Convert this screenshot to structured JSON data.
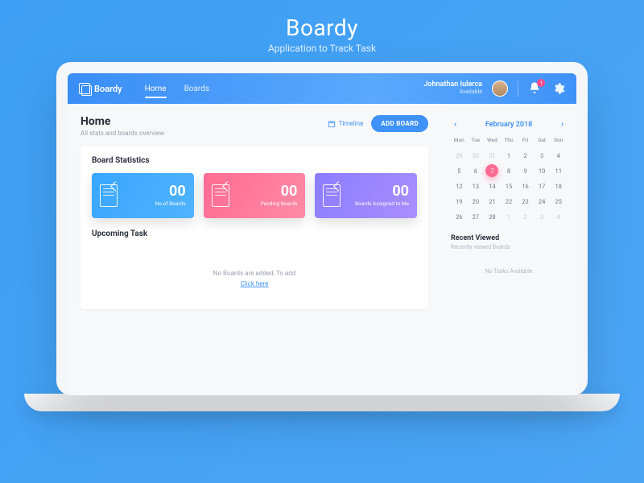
{
  "brand": {
    "title": "Boardy",
    "tagline": "Application to Track Task"
  },
  "nav": {
    "logo_text": "Boardy",
    "tabs": [
      {
        "label": "Home",
        "active": true
      },
      {
        "label": "Boards",
        "active": false
      }
    ],
    "user": {
      "name": "Johnathan Iulerca",
      "status": "Available"
    },
    "notification_count": "1"
  },
  "page": {
    "title": "Home",
    "subtitle": "All stats and boards overview",
    "timeline_label": "Timeline",
    "add_board_label": "ADD BOARD"
  },
  "stats": {
    "heading": "Board Statistics",
    "cards": [
      {
        "value": "00",
        "label": "No.of Boards"
      },
      {
        "value": "00",
        "label": "Pending Boards"
      },
      {
        "value": "00",
        "label": "Boards Assigned to Me"
      }
    ]
  },
  "upcoming": {
    "heading": "Upcoming Task",
    "empty_line": "No Boards are added, To add",
    "empty_link": "Click here"
  },
  "calendar": {
    "month_label": "February 2018",
    "dow": [
      "Mon",
      "Tue",
      "Wed",
      "Thu",
      "Fri",
      "Sat",
      "Sun"
    ],
    "selected_day": 7,
    "weeks": [
      [
        {
          "d": 29,
          "m": true
        },
        {
          "d": 30,
          "m": true
        },
        {
          "d": 31,
          "m": true
        },
        {
          "d": 1
        },
        {
          "d": 2
        },
        {
          "d": 3
        },
        {
          "d": 4
        }
      ],
      [
        {
          "d": 5
        },
        {
          "d": 6
        },
        {
          "d": 7,
          "sel": true
        },
        {
          "d": 8
        },
        {
          "d": 9
        },
        {
          "d": 10
        },
        {
          "d": 11
        }
      ],
      [
        {
          "d": 12
        },
        {
          "d": 13
        },
        {
          "d": 14
        },
        {
          "d": 15
        },
        {
          "d": 16
        },
        {
          "d": 17
        },
        {
          "d": 18
        }
      ],
      [
        {
          "d": 19
        },
        {
          "d": 20
        },
        {
          "d": 21
        },
        {
          "d": 22
        },
        {
          "d": 23
        },
        {
          "d": 24
        },
        {
          "d": 25
        }
      ],
      [
        {
          "d": 26
        },
        {
          "d": 27
        },
        {
          "d": 28
        },
        {
          "d": 1,
          "m": true
        },
        {
          "d": 2,
          "m": true
        },
        {
          "d": 3,
          "m": true
        },
        {
          "d": 4,
          "m": true
        }
      ]
    ]
  },
  "recent": {
    "heading": "Recent Viewed",
    "subtitle": "Recently viewed Boards",
    "empty": "No Tasks Available"
  }
}
